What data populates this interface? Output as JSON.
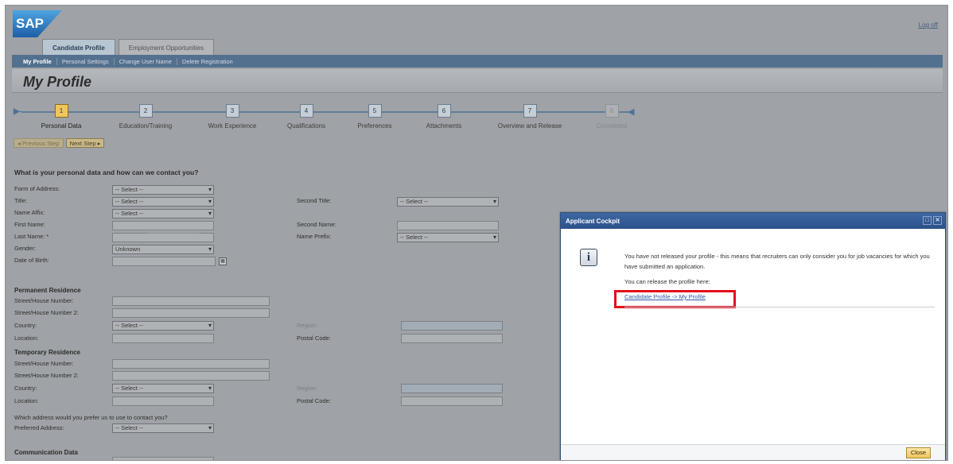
{
  "logo_text": "SAP",
  "header": {
    "logout_label": "Log off"
  },
  "tabs": [
    {
      "label": "Candidate Profile",
      "active": true
    },
    {
      "label": "Employment Opportunities",
      "active": false
    }
  ],
  "subnav": [
    {
      "label": "My Profile",
      "current": true
    },
    {
      "label": "Personal Settings",
      "current": false
    },
    {
      "label": "Change User Name",
      "current": false
    },
    {
      "label": "Delete Registration",
      "current": false
    }
  ],
  "page_title": "My Profile",
  "roadmap": {
    "steps": [
      {
        "num": "1",
        "label": "Personal Data",
        "state": "current"
      },
      {
        "num": "2",
        "label": "Education/Training",
        "state": "normal"
      },
      {
        "num": "3",
        "label": "Work Experience",
        "state": "normal"
      },
      {
        "num": "4",
        "label": "Qualifications",
        "state": "normal"
      },
      {
        "num": "5",
        "label": "Preferences",
        "state": "normal"
      },
      {
        "num": "6",
        "label": "Attachments",
        "state": "normal"
      },
      {
        "num": "7",
        "label": "Overview and Release",
        "state": "normal"
      },
      {
        "num": "8",
        "label": "Completed",
        "state": "disabled"
      }
    ]
  },
  "nav_buttons": {
    "previous": "Previous Step",
    "next": "Next Step"
  },
  "form": {
    "heading": "What is your personal data and how can we contact you?",
    "labels": {
      "form_of_address": "Form of Address:",
      "title": "Title:",
      "name_affix": "Name Affix:",
      "first_name": "First Name:",
      "last_name": "Last Name: *",
      "gender": "Gender:",
      "dob": "Date of Birth:",
      "second_title": "Second Title:",
      "second_name": "Second Name:",
      "name_prefix": "Name Prefix:"
    },
    "values": {
      "form_of_address": "-- Select --",
      "title": "-- Select --",
      "name_affix": "-- Select --",
      "gender": "Unknown",
      "second_title": "-- Select --",
      "name_prefix": "-- Select --"
    },
    "permanent": {
      "heading": "Permanent Residence",
      "street": "Street/House Number:",
      "street2": "Street/House Number 2:",
      "country": "Country:",
      "country_value": "-- Select --",
      "location": "Location:",
      "region": "Region:",
      "postal": "Postal Code:"
    },
    "temporary": {
      "heading": "Temporary Residence",
      "street": "Street/House Number:",
      "street2": "Street/House Number 2:",
      "country": "Country:",
      "country_value": "-- Select --",
      "location": "Location:",
      "region": "Region:",
      "postal": "Postal Code:"
    },
    "contact_question": "Which address would you prefer us to use to contact you?",
    "preferred_label": "Preferred Address:",
    "preferred_value": "-- Select --",
    "communication_heading": "Communication Data"
  },
  "dialog": {
    "title": "Applicant Cockpit",
    "message": "You have not released your profile - this means that recruiters can only consider you for job vacancies for which you have submitted an application.",
    "release_text": "You can release the profile here:",
    "link_text": "Candidate Profile -> My Profile",
    "close_label": "Close",
    "highlight_color": "#e3101a"
  },
  "colors": {
    "nav_bar": "#54708f",
    "dialog_title": "#2c5189",
    "current_step": "#f2c55c",
    "link": "#2c59a6"
  }
}
